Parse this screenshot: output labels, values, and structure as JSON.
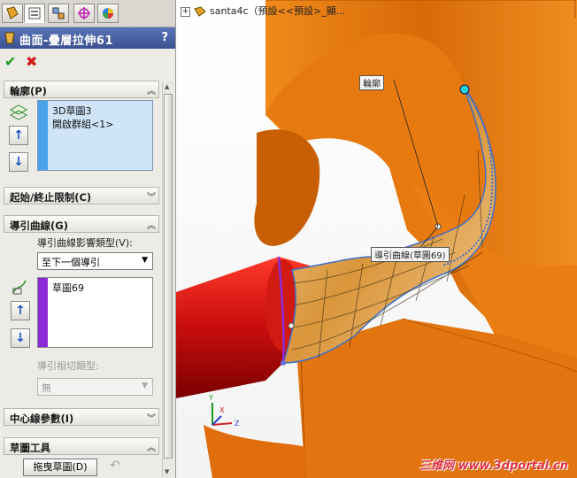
{
  "tabs": [
    "feature-manager",
    "property-manager",
    "configuration-manager",
    "dimxpert-manager",
    "display-manager"
  ],
  "property_manager": {
    "title": "曲面-疊層拉伸61",
    "help": "?"
  },
  "actions": {
    "ok": "✔",
    "cancel": "✖"
  },
  "profiles": {
    "title": "輪廓(P)",
    "items": [
      "3D草圖3",
      "開啟群組<1>"
    ]
  },
  "start_end": {
    "title": "起始/終止限制(C)"
  },
  "guides": {
    "title": "導引曲線(G)",
    "influence_label": "導引曲線影響類型(V):",
    "influence_value": "至下一個導引",
    "items": [
      "草圖69"
    ],
    "tangency_label": "導引相切類型:",
    "tangency_value": "無"
  },
  "centerline": {
    "title": "中心線參數(I)"
  },
  "sketch_tools": {
    "title": "草圖工具",
    "drag_button": "拖曳草圖(D)"
  },
  "graphics": {
    "tree_text": "santa4c（預設<<預設>_顯...",
    "callout_profile": "輪廓",
    "callout_guide": "導引曲線(草圖69)",
    "watermark": "三维网 www.3dportal.cn"
  },
  "colors": {
    "accent": "#3b5191",
    "body": "#e2700a",
    "red_tube": "#c80d0d",
    "guide": "#8b2bd8"
  }
}
